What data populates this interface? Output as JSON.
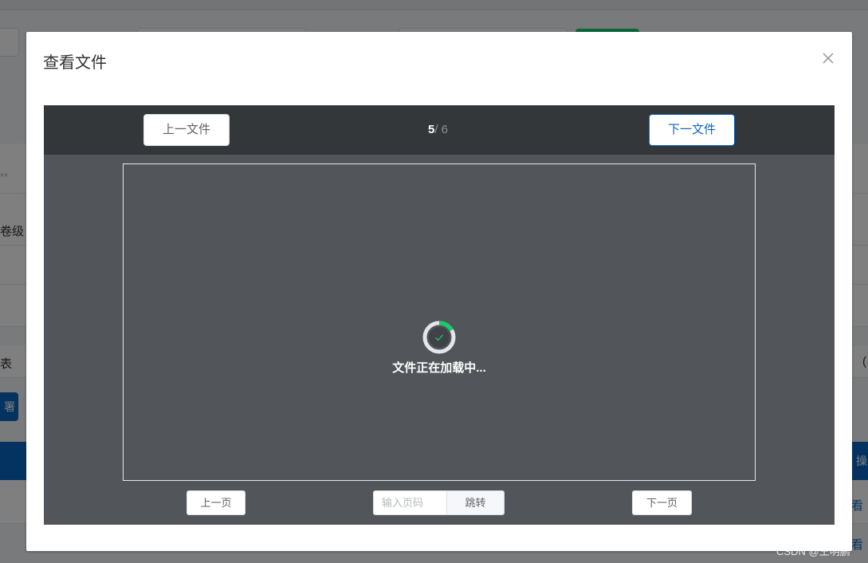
{
  "background": {
    "fragments": [
      "**",
      "卷级",
      "表",
      "署",
      "操",
      "看",
      "看",
      "("
    ]
  },
  "dialog": {
    "title": "查看文件",
    "close_icon": "close-icon",
    "prev_file_label": "上一文件",
    "next_file_label": "下一文件",
    "current_file": "5",
    "total_files": "/ 6",
    "loading_text": "文件正在加载中...",
    "prev_page_label": "上一页",
    "page_input_placeholder": "输入页码",
    "jump_label": "跳转",
    "next_page_label": "下一页"
  },
  "watermark": "CSDN @王明鹏",
  "colors": {
    "accent": "#0a66c2",
    "spinner_progress": "#13ce66",
    "viewer_bg": "#52565a",
    "viewer_bar_bg": "#33373a"
  }
}
